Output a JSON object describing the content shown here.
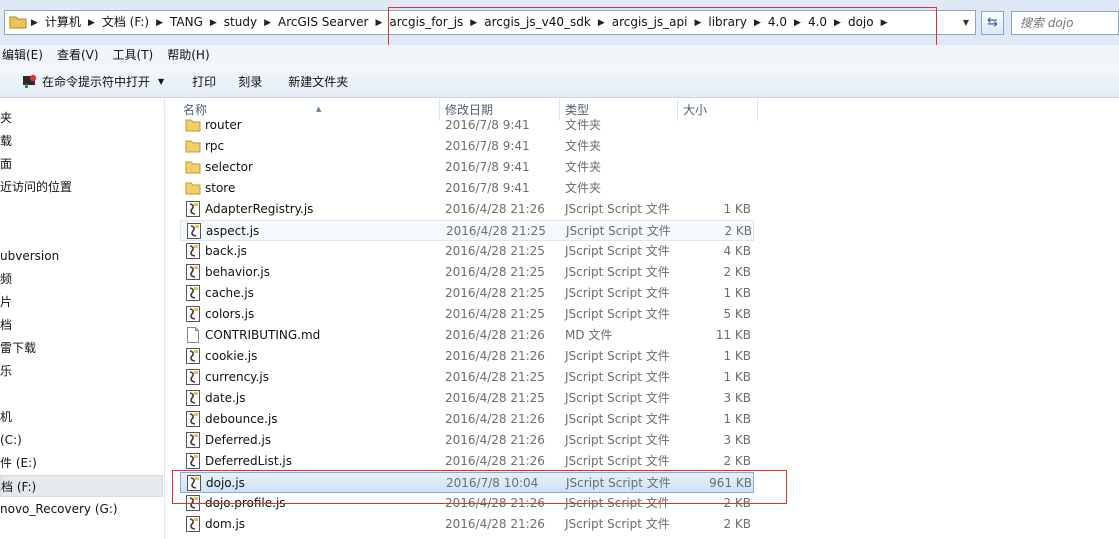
{
  "address": {
    "crumbs": [
      "计算机",
      "文档 (F:)",
      "TANG",
      "study",
      "ArcGIS Searver",
      "arcgis_for_js",
      "arcgis_js_v40_sdk",
      "arcgis_js_api",
      "library",
      "4.0",
      "4.0",
      "dojo"
    ],
    "search_placeholder": "搜索 dojo"
  },
  "menu": [
    "编辑(E)",
    "查看(V)",
    "工具(T)",
    "帮助(H)"
  ],
  "toolbar": {
    "open_cmd": "在命令提示符中打开",
    "print": "打印",
    "burn": "刻录",
    "new_folder": "新建文件夹"
  },
  "nav": {
    "items": [
      "夹",
      "载",
      "面",
      "近访问的位置",
      "ubversion",
      "频",
      "片",
      "档",
      "雷下载",
      "乐",
      "机",
      "(C:)",
      "件 (E:)",
      "档 (F:)",
      "novo_Recovery (G:)"
    ]
  },
  "columns": {
    "name": "名称",
    "date": "修改日期",
    "type": "类型",
    "size": "大小"
  },
  "files": [
    {
      "name": "router",
      "date": "2016/7/8 9:41",
      "type": "文件夹",
      "size": "",
      "kind": "folder"
    },
    {
      "name": "rpc",
      "date": "2016/7/8 9:41",
      "type": "文件夹",
      "size": "",
      "kind": "folder"
    },
    {
      "name": "selector",
      "date": "2016/7/8 9:41",
      "type": "文件夹",
      "size": "",
      "kind": "folder"
    },
    {
      "name": "store",
      "date": "2016/7/8 9:41",
      "type": "文件夹",
      "size": "",
      "kind": "folder"
    },
    {
      "name": "AdapterRegistry.js",
      "date": "2016/4/28 21:26",
      "type": "JScript Script 文件",
      "size": "1 KB",
      "kind": "js"
    },
    {
      "name": "aspect.js",
      "date": "2016/4/28 21:25",
      "type": "JScript Script 文件",
      "size": "2 KB",
      "kind": "js"
    },
    {
      "name": "back.js",
      "date": "2016/4/28 21:25",
      "type": "JScript Script 文件",
      "size": "4 KB",
      "kind": "js"
    },
    {
      "name": "behavior.js",
      "date": "2016/4/28 21:25",
      "type": "JScript Script 文件",
      "size": "2 KB",
      "kind": "js"
    },
    {
      "name": "cache.js",
      "date": "2016/4/28 21:25",
      "type": "JScript Script 文件",
      "size": "1 KB",
      "kind": "js"
    },
    {
      "name": "colors.js",
      "date": "2016/4/28 21:25",
      "type": "JScript Script 文件",
      "size": "5 KB",
      "kind": "js"
    },
    {
      "name": "CONTRIBUTING.md",
      "date": "2016/4/28 21:26",
      "type": "MD 文件",
      "size": "11 KB",
      "kind": "doc"
    },
    {
      "name": "cookie.js",
      "date": "2016/4/28 21:26",
      "type": "JScript Script 文件",
      "size": "1 KB",
      "kind": "js"
    },
    {
      "name": "currency.js",
      "date": "2016/4/28 21:25",
      "type": "JScript Script 文件",
      "size": "1 KB",
      "kind": "js"
    },
    {
      "name": "date.js",
      "date": "2016/4/28 21:25",
      "type": "JScript Script 文件",
      "size": "3 KB",
      "kind": "js"
    },
    {
      "name": "debounce.js",
      "date": "2016/4/28 21:26",
      "type": "JScript Script 文件",
      "size": "1 KB",
      "kind": "js"
    },
    {
      "name": "Deferred.js",
      "date": "2016/4/28 21:26",
      "type": "JScript Script 文件",
      "size": "3 KB",
      "kind": "js"
    },
    {
      "name": "DeferredList.js",
      "date": "2016/4/28 21:26",
      "type": "JScript Script 文件",
      "size": "2 KB",
      "kind": "js"
    },
    {
      "name": "dojo.js",
      "date": "2016/7/8 10:04",
      "type": "JScript Script 文件",
      "size": "961 KB",
      "kind": "js"
    },
    {
      "name": "dojo.profile.js",
      "date": "2016/4/28 21:26",
      "type": "JScript Script 文件",
      "size": "2 KB",
      "kind": "js"
    },
    {
      "name": "dom.js",
      "date": "2016/4/28 21:26",
      "type": "JScript Script 文件",
      "size": "2 KB",
      "kind": "js"
    }
  ],
  "colors": {
    "highlight": "#e03030",
    "selection": "#cfe2f8"
  }
}
